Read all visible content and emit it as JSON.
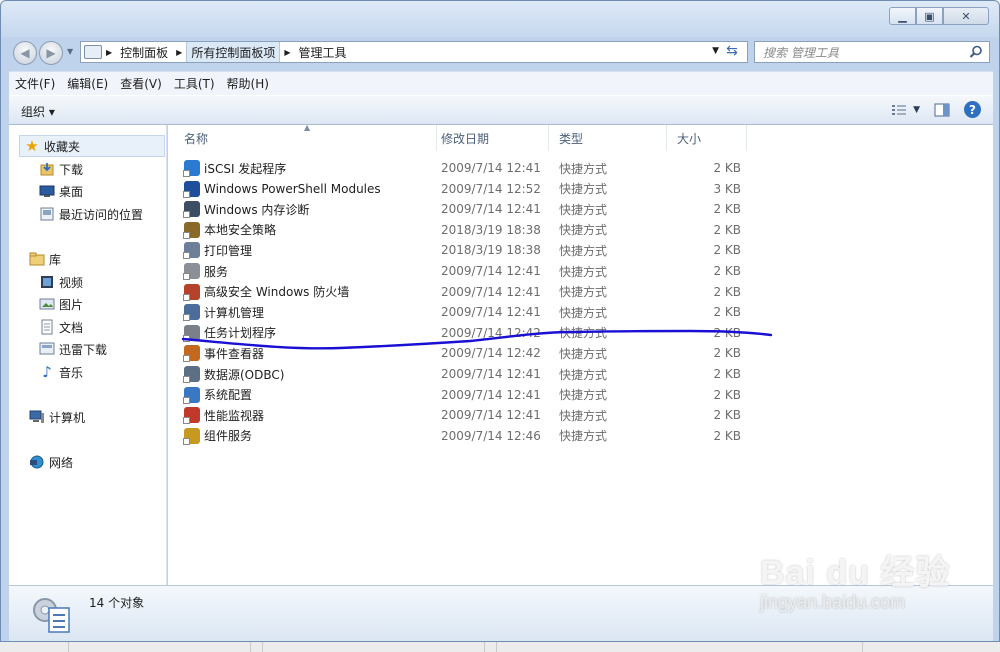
{
  "window": {
    "controls": [
      "minimize",
      "restore",
      "close"
    ]
  },
  "address": {
    "crumbs": [
      "控制面板",
      "所有控制面板项",
      "管理工具"
    ],
    "search_placeholder": "搜索 管理工具"
  },
  "menu": [
    "文件(F)",
    "编辑(E)",
    "查看(V)",
    "工具(T)",
    "帮助(H)"
  ],
  "toolbar": {
    "organize_label": "组织 ▾"
  },
  "navpane": {
    "favorites": {
      "label": "收藏夹",
      "items": [
        "下载",
        "桌面",
        "最近访问的位置"
      ]
    },
    "libraries": {
      "label": "库",
      "items": [
        "视频",
        "图片",
        "文档",
        "迅雷下载",
        "音乐"
      ]
    },
    "computer": "计算机",
    "network": "网络"
  },
  "columns": [
    "名称",
    "修改日期",
    "类型",
    "大小"
  ],
  "files": [
    {
      "name": "iSCSI 发起程序",
      "date": "2009/7/14 12:41",
      "type": "快捷方式",
      "size": "2 KB",
      "icon": "iscsi-icon",
      "color": "#2a7ad1"
    },
    {
      "name": "Windows PowerShell Modules",
      "date": "2009/7/14 12:52",
      "type": "快捷方式",
      "size": "3 KB",
      "icon": "powershell-icon",
      "color": "#1f4f9a"
    },
    {
      "name": "Windows 内存诊断",
      "date": "2009/7/14 12:41",
      "type": "快捷方式",
      "size": "2 KB",
      "icon": "memory-diagnostic-icon",
      "color": "#3d4d63"
    },
    {
      "name": "本地安全策略",
      "date": "2018/3/19 18:38",
      "type": "快捷方式",
      "size": "2 KB",
      "icon": "security-policy-icon",
      "color": "#8a6a2a"
    },
    {
      "name": "打印管理",
      "date": "2018/3/19 18:38",
      "type": "快捷方式",
      "size": "2 KB",
      "icon": "print-management-icon",
      "color": "#6b7f99"
    },
    {
      "name": "服务",
      "date": "2009/7/14 12:41",
      "type": "快捷方式",
      "size": "2 KB",
      "icon": "services-gear-icon",
      "color": "#8a8f98"
    },
    {
      "name": "高级安全 Windows 防火墙",
      "date": "2009/7/14 12:41",
      "type": "快捷方式",
      "size": "2 KB",
      "icon": "firewall-icon",
      "color": "#b5432b"
    },
    {
      "name": "计算机管理",
      "date": "2009/7/14 12:41",
      "type": "快捷方式",
      "size": "2 KB",
      "icon": "computer-management-icon",
      "color": "#4a6d9c"
    },
    {
      "name": "任务计划程序",
      "date": "2009/7/14 12:42",
      "type": "快捷方式",
      "size": "2 KB",
      "icon": "task-scheduler-icon",
      "color": "#7a7f88"
    },
    {
      "name": "事件查看器",
      "date": "2009/7/14 12:42",
      "type": "快捷方式",
      "size": "2 KB",
      "icon": "event-viewer-icon",
      "color": "#c2681f"
    },
    {
      "name": "数据源(ODBC)",
      "date": "2009/7/14 12:41",
      "type": "快捷方式",
      "size": "2 KB",
      "icon": "odbc-icon",
      "color": "#5d6f85"
    },
    {
      "name": "系统配置",
      "date": "2009/7/14 12:41",
      "type": "快捷方式",
      "size": "2 KB",
      "icon": "system-config-icon",
      "color": "#3b78c4"
    },
    {
      "name": "性能监视器",
      "date": "2009/7/14 12:41",
      "type": "快捷方式",
      "size": "2 KB",
      "icon": "performance-monitor-icon",
      "color": "#c0392b"
    },
    {
      "name": "组件服务",
      "date": "2009/7/14 12:46",
      "type": "快捷方式",
      "size": "2 KB",
      "icon": "component-services-icon",
      "color": "#c79a1f"
    }
  ],
  "details": {
    "count_text": "14 个对象"
  },
  "watermark": {
    "logo": "Bai du 经验",
    "sub": "jingyan.baidu.com"
  },
  "annotation": {
    "stroke_color": "#1a10d4"
  }
}
